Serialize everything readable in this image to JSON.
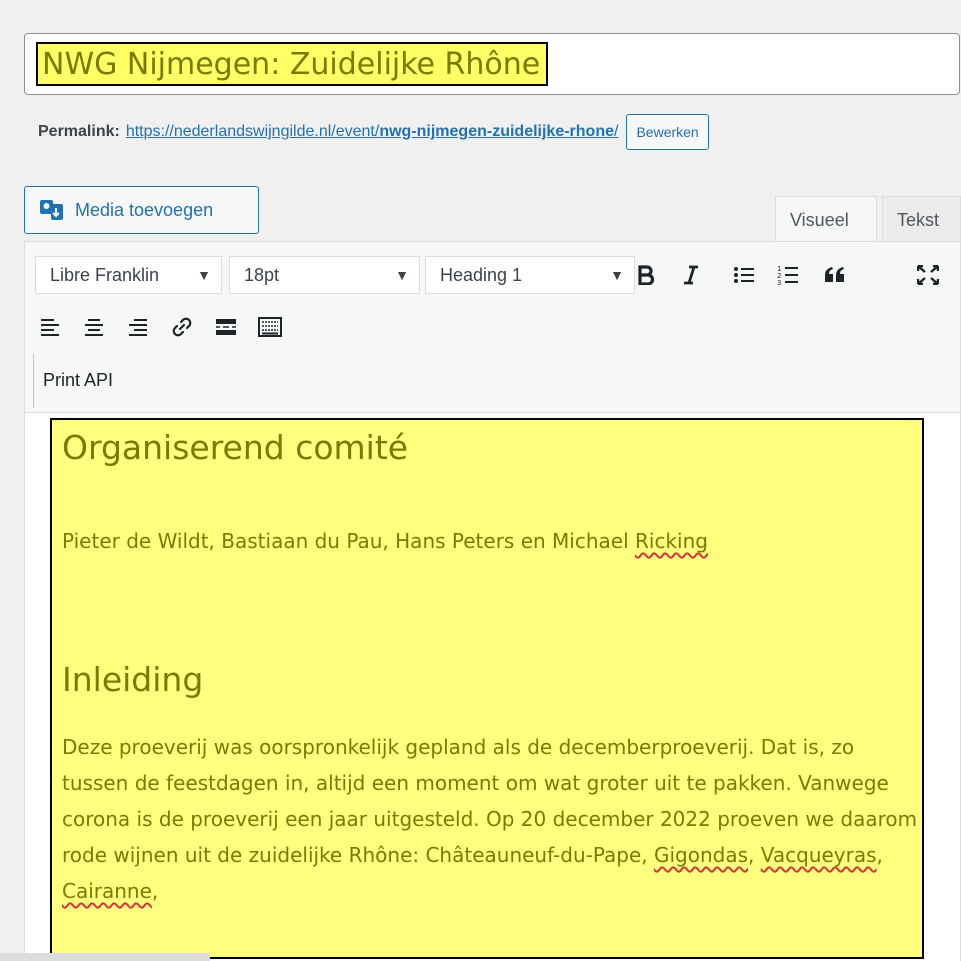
{
  "post_title": "NWG Nijmegen: Zuidelijke Rhône",
  "permalink": {
    "label": "Permalink:",
    "url_base": "https://nederlandswijngilde.nl/event/",
    "slug": "nwg-nijmegen-zuidelijke-rhone",
    "url_end": "/",
    "edit_label": "Bewerken"
  },
  "media_button": {
    "label": "Media toevoegen",
    "icon": "media-add-icon"
  },
  "editor_tabs": {
    "visual": "Visueel",
    "text": "Tekst",
    "active": "visual"
  },
  "toolbar": {
    "font_family": "Libre Franklin",
    "font_size": "18pt",
    "format": "Heading 1",
    "row1_icons": [
      "bold-icon",
      "italic-icon",
      "bullet-list-icon",
      "numbered-list-icon",
      "blockquote-icon",
      "fullscreen-icon"
    ],
    "row2_icons": [
      "align-left-icon",
      "align-center-icon",
      "align-right-icon",
      "link-icon",
      "read-more-icon",
      "toolbar-toggle-icon"
    ],
    "print_api_label": "Print API",
    "dropdown_arrow": "▼"
  },
  "content": {
    "heading_1": "Organiserend comité",
    "paragraph_1_before": "Pieter de Wildt, Bastiaan du Pau, Hans Peters en Michael ",
    "paragraph_1_spell": "Ricking",
    "heading_2": "Inleiding",
    "paragraph_2_a": "Deze proeverij was oorspronkelijk gepland als de decemberproeverij. Dat is, zo tussen de feestdagen in, altijd een moment om wat groter uit te pakken. Vanwege corona is de proeverij een jaar uitgesteld. Op 20 december 2022 proeven we daarom rode wijnen uit de zuidelijke Rhône: Châteauneuf-du-Pape, ",
    "spell_1": "Gigondas",
    "sep_1": ", ",
    "spell_2": "Vacqueyras",
    "sep_2": ", ",
    "spell_3": "Cairanne",
    "sep_3": ","
  },
  "colors": {
    "highlight": "#ffff80",
    "highlight_text": "#7a7a00",
    "accent": "#2271b1",
    "spellcheck": "#d63638"
  }
}
